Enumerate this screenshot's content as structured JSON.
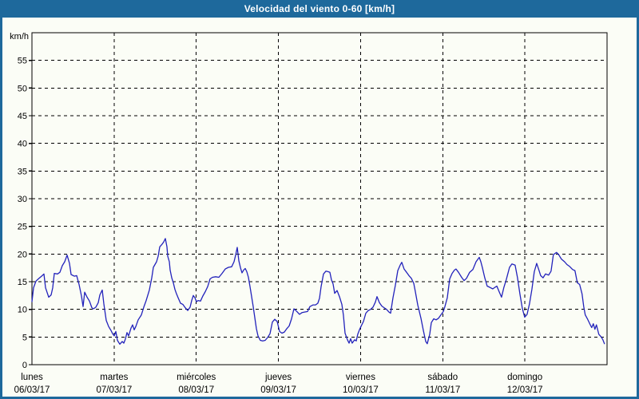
{
  "window": {
    "title": "Velocidad del viento 0-60 [km/h]"
  },
  "colors": {
    "title_bar": "#1e699c",
    "frame": "#1e699c",
    "title_text": "#ffffff",
    "plot_background": "#fbfdf6",
    "grid": "#000000",
    "axis": "#000000",
    "label_text": "#000000",
    "line": "#2222bb"
  },
  "chart_data": {
    "type": "line",
    "title": "Velocidad del viento 0-60 [km/h]",
    "grid": "dashed",
    "legend": "none",
    "y_axis": {
      "unit_label": "km/h",
      "min": 0,
      "max": 60,
      "tick_step": 5,
      "tick_labels": [
        "0",
        "5",
        "10",
        "15",
        "20",
        "25",
        "30",
        "35",
        "40",
        "45",
        "50",
        "55"
      ]
    },
    "x_axis": {
      "days": [
        {
          "name": "lunes",
          "date": "06/03/17"
        },
        {
          "name": "martes",
          "date": "07/03/17"
        },
        {
          "name": "miércoles",
          "date": "08/03/17"
        },
        {
          "name": "jueves",
          "date": "09/03/17"
        },
        {
          "name": "viernes",
          "date": "10/03/17"
        },
        {
          "name": "sábado",
          "date": "11/03/17"
        },
        {
          "name": "domingo",
          "date": "12/03/17"
        }
      ]
    },
    "series": [
      {
        "name": "Velocidad del viento",
        "unit": "km/h",
        "points": [
          [
            0.0,
            11.4
          ],
          [
            0.019,
            13.9
          ],
          [
            0.049,
            15.1
          ],
          [
            0.078,
            15.5
          ],
          [
            0.117,
            16.0
          ],
          [
            0.146,
            16.4
          ],
          [
            0.165,
            13.9
          ],
          [
            0.204,
            12.2
          ],
          [
            0.233,
            12.6
          ],
          [
            0.253,
            13.9
          ],
          [
            0.272,
            16.5
          ],
          [
            0.311,
            16.4
          ],
          [
            0.34,
            16.7
          ],
          [
            0.369,
            17.9
          ],
          [
            0.399,
            18.6
          ],
          [
            0.428,
            19.8
          ],
          [
            0.457,
            18.3
          ],
          [
            0.476,
            16.3
          ],
          [
            0.515,
            16.0
          ],
          [
            0.544,
            16.1
          ],
          [
            0.574,
            14.5
          ],
          [
            0.603,
            12.4
          ],
          [
            0.622,
            10.5
          ],
          [
            0.642,
            13.1
          ],
          [
            0.671,
            12.2
          ],
          [
            0.7,
            11.5
          ],
          [
            0.729,
            10.3
          ],
          [
            0.749,
            10.1
          ],
          [
            0.778,
            10.4
          ],
          [
            0.807,
            11.2
          ],
          [
            0.826,
            12.6
          ],
          [
            0.856,
            13.5
          ],
          [
            0.875,
            11.0
          ],
          [
            0.904,
            8.0
          ],
          [
            0.933,
            6.9
          ],
          [
            0.962,
            6.2
          ],
          [
            0.982,
            5.6
          ],
          [
            1.001,
            5.2
          ],
          [
            1.021,
            6.0
          ],
          [
            1.04,
            4.4
          ],
          [
            1.069,
            3.7
          ],
          [
            1.099,
            4.2
          ],
          [
            1.118,
            3.9
          ],
          [
            1.137,
            4.6
          ],
          [
            1.157,
            5.8
          ],
          [
            1.176,
            5.2
          ],
          [
            1.206,
            6.6
          ],
          [
            1.225,
            7.2
          ],
          [
            1.244,
            6.3
          ],
          [
            1.264,
            6.9
          ],
          [
            1.293,
            8.1
          ],
          [
            1.332,
            9.0
          ],
          [
            1.361,
            10.4
          ],
          [
            1.39,
            11.6
          ],
          [
            1.429,
            13.5
          ],
          [
            1.458,
            15.7
          ],
          [
            1.478,
            17.6
          ],
          [
            1.497,
            18.1
          ],
          [
            1.517,
            18.6
          ],
          [
            1.536,
            19.6
          ],
          [
            1.556,
            21.3
          ],
          [
            1.585,
            21.8
          ],
          [
            1.604,
            22.2
          ],
          [
            1.624,
            22.8
          ],
          [
            1.643,
            21.3
          ],
          [
            1.653,
            19.6
          ],
          [
            1.672,
            18.6
          ],
          [
            1.682,
            17.1
          ],
          [
            1.701,
            15.7
          ],
          [
            1.721,
            14.8
          ],
          [
            1.74,
            13.6
          ],
          [
            1.76,
            12.8
          ],
          [
            1.779,
            12.1
          ],
          [
            1.808,
            11.1
          ],
          [
            1.837,
            10.9
          ],
          [
            1.866,
            10.3
          ],
          [
            1.896,
            9.8
          ],
          [
            1.925,
            10.4
          ],
          [
            1.944,
            11.6
          ],
          [
            1.964,
            12.5
          ],
          [
            1.983,
            12.1
          ],
          [
            2.003,
            11.4
          ],
          [
            2.022,
            11.6
          ],
          [
            2.051,
            11.5
          ],
          [
            2.08,
            12.4
          ],
          [
            2.11,
            13.2
          ],
          [
            2.139,
            14.1
          ],
          [
            2.168,
            15.5
          ],
          [
            2.197,
            15.8
          ],
          [
            2.236,
            15.9
          ],
          [
            2.275,
            15.8
          ],
          [
            2.314,
            16.5
          ],
          [
            2.353,
            17.3
          ],
          [
            2.392,
            17.6
          ],
          [
            2.431,
            17.7
          ],
          [
            2.46,
            18.6
          ],
          [
            2.479,
            19.8
          ],
          [
            2.499,
            21.2
          ],
          [
            2.518,
            18.8
          ],
          [
            2.538,
            17.5
          ],
          [
            2.557,
            16.6
          ],
          [
            2.576,
            17.1
          ],
          [
            2.596,
            17.4
          ],
          [
            2.615,
            16.8
          ],
          [
            2.635,
            15.8
          ],
          [
            2.654,
            14.1
          ],
          [
            2.673,
            12.4
          ],
          [
            2.693,
            10.5
          ],
          [
            2.712,
            8.6
          ],
          [
            2.732,
            6.5
          ],
          [
            2.751,
            5.2
          ],
          [
            2.78,
            4.4
          ],
          [
            2.809,
            4.3
          ],
          [
            2.839,
            4.4
          ],
          [
            2.868,
            4.9
          ],
          [
            2.897,
            5.6
          ],
          [
            2.926,
            7.7
          ],
          [
            2.956,
            8.2
          ],
          [
            2.985,
            7.8
          ],
          [
            3.014,
            6.0
          ],
          [
            3.043,
            5.7
          ],
          [
            3.072,
            5.9
          ],
          [
            3.101,
            6.5
          ],
          [
            3.131,
            7.0
          ],
          [
            3.16,
            8.3
          ],
          [
            3.189,
            10.1
          ],
          [
            3.218,
            9.7
          ],
          [
            3.257,
            9.1
          ],
          [
            3.286,
            9.4
          ],
          [
            3.315,
            9.5
          ],
          [
            3.354,
            9.6
          ],
          [
            3.383,
            10.5
          ],
          [
            3.422,
            10.8
          ],
          [
            3.451,
            10.8
          ],
          [
            3.48,
            11.1
          ],
          [
            3.5,
            12.0
          ],
          [
            3.519,
            14.1
          ],
          [
            3.549,
            16.4
          ],
          [
            3.578,
            16.9
          ],
          [
            3.607,
            16.8
          ],
          [
            3.626,
            16.7
          ],
          [
            3.646,
            15.3
          ],
          [
            3.665,
            14.6
          ],
          [
            3.685,
            12.9
          ],
          [
            3.714,
            13.4
          ],
          [
            3.743,
            12.3
          ],
          [
            3.772,
            10.9
          ],
          [
            3.791,
            9.0
          ],
          [
            3.811,
            5.7
          ],
          [
            3.84,
            4.5
          ],
          [
            3.86,
            3.9
          ],
          [
            3.879,
            4.7
          ],
          [
            3.898,
            3.9
          ],
          [
            3.928,
            4.5
          ],
          [
            3.947,
            4.3
          ],
          [
            3.966,
            5.5
          ],
          [
            3.986,
            6.3
          ],
          [
            4.005,
            6.9
          ],
          [
            4.035,
            7.8
          ],
          [
            4.064,
            9.3
          ],
          [
            4.093,
            9.8
          ],
          [
            4.122,
            10.0
          ],
          [
            4.151,
            10.4
          ],
          [
            4.18,
            11.3
          ],
          [
            4.2,
            12.3
          ],
          [
            4.229,
            11.2
          ],
          [
            4.258,
            10.6
          ],
          [
            4.287,
            10.3
          ],
          [
            4.316,
            10.0
          ],
          [
            4.346,
            9.5
          ],
          [
            4.365,
            9.3
          ],
          [
            4.394,
            12.1
          ],
          [
            4.423,
            14.3
          ],
          [
            4.453,
            17.0
          ],
          [
            4.482,
            18.0
          ],
          [
            4.501,
            18.5
          ],
          [
            4.53,
            17.3
          ],
          [
            4.56,
            16.7
          ],
          [
            4.589,
            16.1
          ],
          [
            4.618,
            15.6
          ],
          [
            4.647,
            14.7
          ],
          [
            4.667,
            13.2
          ],
          [
            4.696,
            10.8
          ],
          [
            4.735,
            8.4
          ],
          [
            4.764,
            6.2
          ],
          [
            4.793,
            4.2
          ],
          [
            4.812,
            3.8
          ],
          [
            4.842,
            5.5
          ],
          [
            4.861,
            7.6
          ],
          [
            4.89,
            8.3
          ],
          [
            4.919,
            8.1
          ],
          [
            4.949,
            8.4
          ],
          [
            4.978,
            9.0
          ],
          [
            5.007,
            9.6
          ],
          [
            5.026,
            10.5
          ],
          [
            5.056,
            12.1
          ],
          [
            5.085,
            15.5
          ],
          [
            5.114,
            16.5
          ],
          [
            5.143,
            17.1
          ],
          [
            5.162,
            17.3
          ],
          [
            5.192,
            16.7
          ],
          [
            5.23,
            15.8
          ],
          [
            5.26,
            15.2
          ],
          [
            5.289,
            15.6
          ],
          [
            5.328,
            16.7
          ],
          [
            5.367,
            17.2
          ],
          [
            5.406,
            18.6
          ],
          [
            5.444,
            19.4
          ],
          [
            5.464,
            18.6
          ],
          [
            5.483,
            17.5
          ],
          [
            5.512,
            15.7
          ],
          [
            5.541,
            14.2
          ],
          [
            5.57,
            14.0
          ],
          [
            5.609,
            13.7
          ],
          [
            5.638,
            14.0
          ],
          [
            5.658,
            14.2
          ],
          [
            5.687,
            13.2
          ],
          [
            5.716,
            12.2
          ],
          [
            5.745,
            14.0
          ],
          [
            5.774,
            15.4
          ],
          [
            5.813,
            17.6
          ],
          [
            5.842,
            18.2
          ],
          [
            5.881,
            18.0
          ],
          [
            5.91,
            15.7
          ],
          [
            5.939,
            12.8
          ],
          [
            5.968,
            10.2
          ],
          [
            5.998,
            8.6
          ],
          [
            6.027,
            9.1
          ],
          [
            6.056,
            11.0
          ],
          [
            6.085,
            13.6
          ],
          [
            6.114,
            16.8
          ],
          [
            6.143,
            18.3
          ],
          [
            6.173,
            17.0
          ],
          [
            6.192,
            16.1
          ],
          [
            6.221,
            15.7
          ],
          [
            6.25,
            16.4
          ],
          [
            6.289,
            16.2
          ],
          [
            6.318,
            16.9
          ],
          [
            6.347,
            19.9
          ],
          [
            6.386,
            20.3
          ],
          [
            6.415,
            19.8
          ],
          [
            6.444,
            19.1
          ],
          [
            6.483,
            18.6
          ],
          [
            6.512,
            18.1
          ],
          [
            6.541,
            17.8
          ],
          [
            6.58,
            17.2
          ],
          [
            6.609,
            17.0
          ],
          [
            6.638,
            14.8
          ],
          [
            6.667,
            14.5
          ],
          [
            6.696,
            12.8
          ],
          [
            6.716,
            10.5
          ],
          [
            6.735,
            9.0
          ],
          [
            6.764,
            8.2
          ],
          [
            6.793,
            7.3
          ],
          [
            6.813,
            6.7
          ],
          [
            6.833,
            7.4
          ],
          [
            6.852,
            6.4
          ],
          [
            6.871,
            7.2
          ],
          [
            6.9,
            5.5
          ],
          [
            6.93,
            5.0
          ],
          [
            6.949,
            4.5
          ],
          [
            6.968,
            3.8
          ]
        ]
      }
    ]
  }
}
